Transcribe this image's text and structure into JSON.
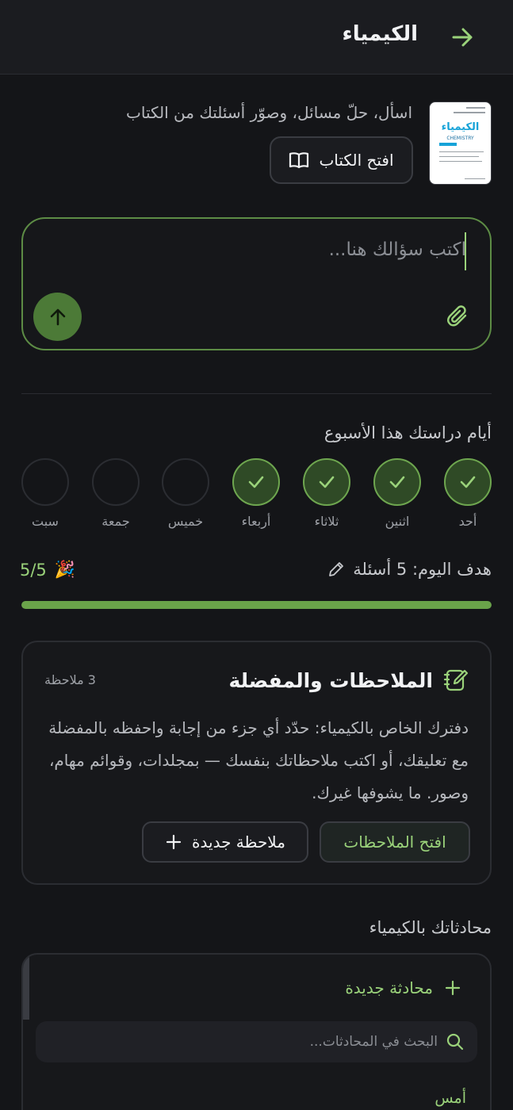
{
  "header": {
    "title": "الكيمياء",
    "back_icon": "arrow-right-icon"
  },
  "book": {
    "thumb_title": "الكيمياء",
    "thumb_subtitle": "CHEMISTRY",
    "intro": "اسأل، حلّ مسائل، وصوّر أسئلتك من الكتاب",
    "open_label": "افتح الكتاب"
  },
  "composer": {
    "placeholder": "اكتب سؤالك هنا...",
    "value": ""
  },
  "week": {
    "title": "أيام دراستك هذا الأسبوع",
    "days": [
      {
        "label": "أحد",
        "done": true
      },
      {
        "label": "اثنين",
        "done": true
      },
      {
        "label": "ثلاثاء",
        "done": true
      },
      {
        "label": "أربعاء",
        "done": true
      },
      {
        "label": "خميس",
        "done": false
      },
      {
        "label": "جمعة",
        "done": false
      },
      {
        "label": "سبت",
        "done": false
      }
    ]
  },
  "goal": {
    "label": "هدف اليوم: 5 أسئلة",
    "count": "5/5",
    "progress": 1.0,
    "celebrate_emoji": "🎉"
  },
  "notes": {
    "title": "الملاحظات والمفضلة",
    "count": "3 ملاحظة",
    "description": "دفترك الخاص بالكيمياء: حدّد أي جزء من إجابة واحفظه بالمفضلة مع تعليقك، أو اكتب ملاحظاتك بنفسك — بمجلدات، وقوائم مهام، وصور. ما يشوفها غيرك.",
    "open_label": "افتح الملاحظات",
    "new_label": "ملاحظة جديدة"
  },
  "chats": {
    "title": "محادثاتك بالكيمياء",
    "new_label": "محادثة جديدة",
    "search_placeholder": "البحث في المحادثات...",
    "group_yesterday": "أمس"
  },
  "colors": {
    "accent": "#9ad27a",
    "accent_dark": "#4c7a37",
    "background": "#141518"
  }
}
